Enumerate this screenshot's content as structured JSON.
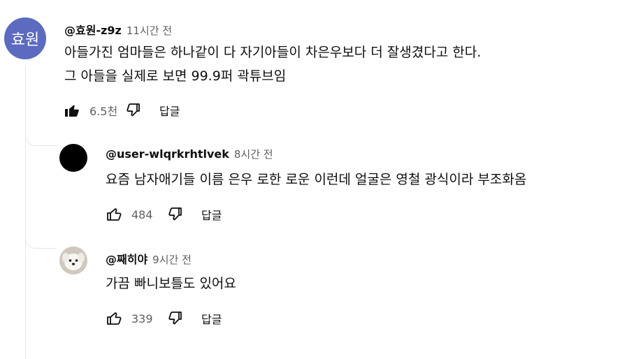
{
  "comments": [
    {
      "avatar_text": "효원",
      "author": "@효원-z9z",
      "time": "11시간 전",
      "lines": [
        "아들가진 엄마들은 하나같이 다 자기아들이 차은우보다 더 잘생겼다고 한다.",
        "그 아들을 실제로 보면 99.9퍼 곽튜브임"
      ],
      "likes": "6.5천",
      "liked": true,
      "reply_label": "답글"
    }
  ],
  "replies": [
    {
      "author": "@user-wlqrkrhtlvek",
      "time": "8시간 전",
      "lines": [
        "요즘 남자애기들 이름 은우 로한 로운 이런데 얼굴은 영철 광식이라 부조화옴"
      ],
      "likes": "484",
      "liked": false,
      "reply_label": "답글"
    },
    {
      "author": "@째히야",
      "time": "9시간 전",
      "lines": [
        "가끔 빠니보틀도 있어요"
      ],
      "likes": "339",
      "liked": false,
      "reply_label": "답글"
    }
  ],
  "icons": {
    "like": "thumbs-up-icon",
    "dislike": "thumbs-down-icon"
  },
  "colors": {
    "avatar_bg": "#5c6bc0",
    "meta_text": "#606060"
  }
}
